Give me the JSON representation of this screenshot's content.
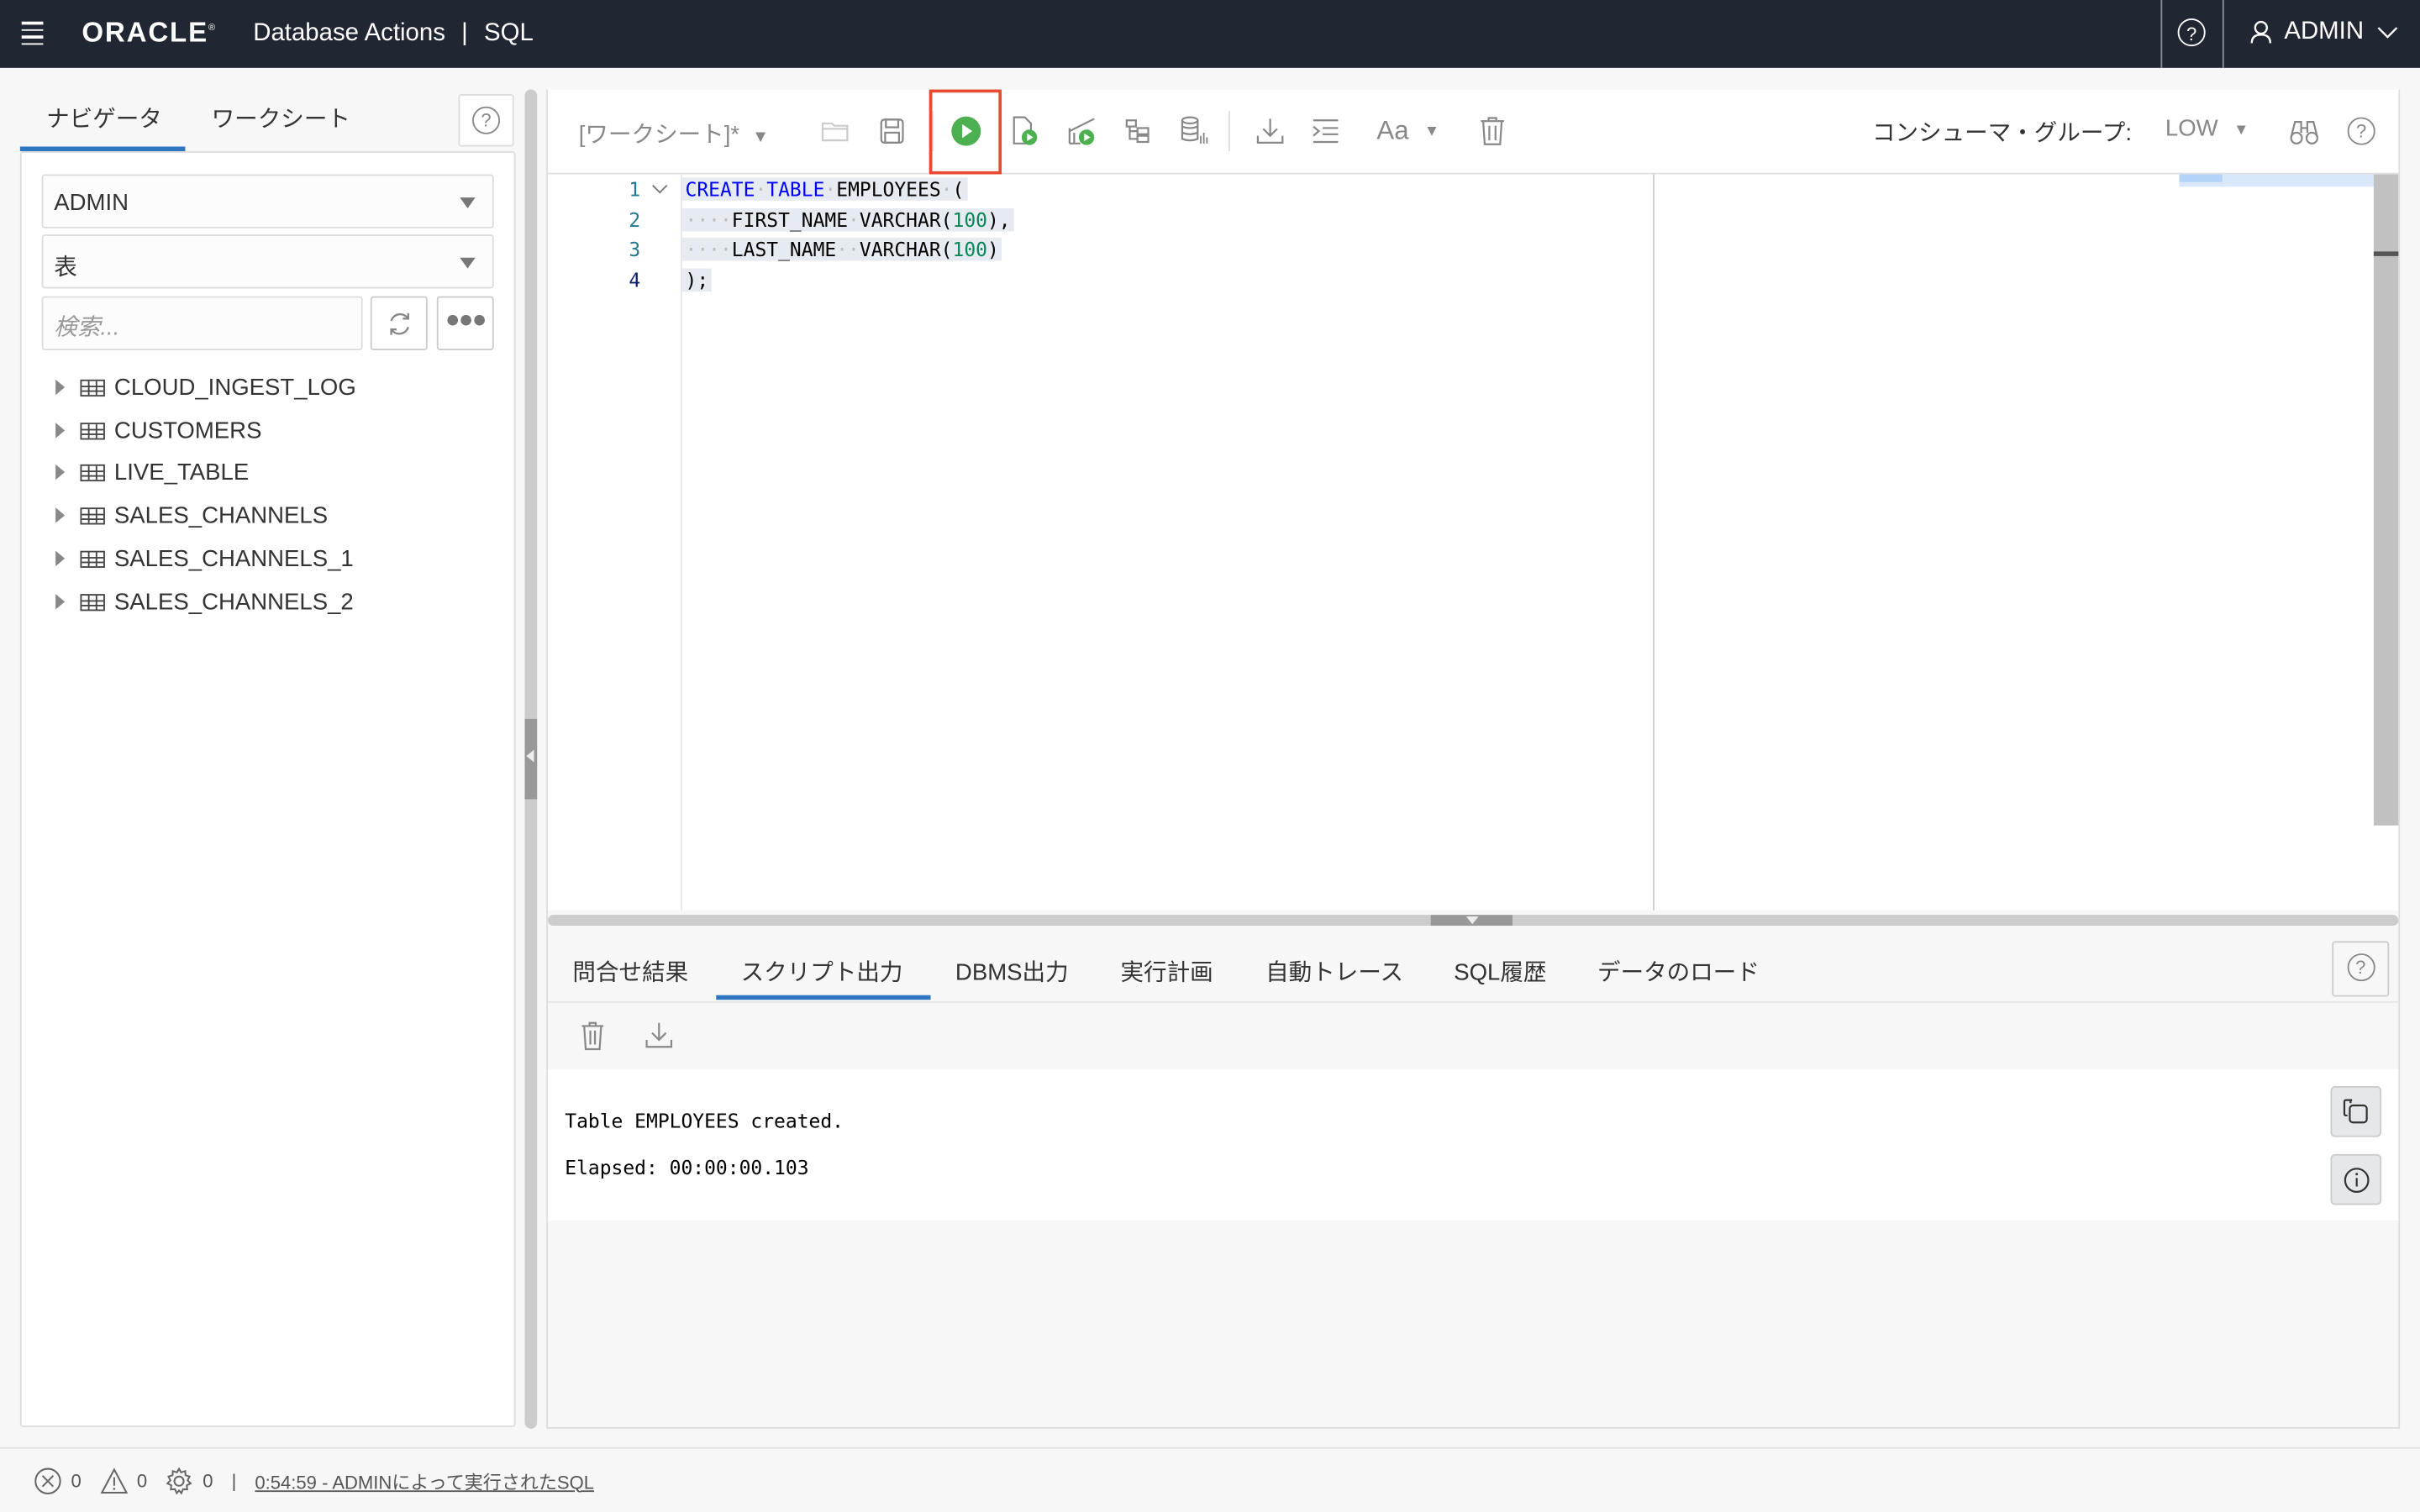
{
  "header": {
    "logo": "ORACLE",
    "app_title": "Database Actions",
    "separator": "|",
    "section": "SQL",
    "user": "ADMIN",
    "help_glyph": "?"
  },
  "navigator": {
    "tabs": [
      {
        "label": "ナビゲータ",
        "active": true
      },
      {
        "label": "ワークシート",
        "active": false
      }
    ],
    "schema": "ADMIN",
    "object_type": "表",
    "search_placeholder": "検索...",
    "tables": [
      "CLOUD_INGEST_LOG",
      "CUSTOMERS",
      "LIVE_TABLE",
      "SALES_CHANNELS",
      "SALES_CHANNELS_1",
      "SALES_CHANNELS_2"
    ]
  },
  "toolbar": {
    "worksheet_name": "[ワークシート]*",
    "consumer_group_label": "コンシューマ・グループ:",
    "consumer_group_value": "LOW",
    "font_label": "Aa",
    "highlighted_button": "run-statement-button",
    "run_color": "#4caf50",
    "highlight_color": "#e84a2f"
  },
  "editor": {
    "lines": [
      {
        "n": "1",
        "tokens": [
          [
            "kw",
            "CREATE"
          ],
          [
            "dot",
            "·"
          ],
          [
            "kw",
            "TABLE"
          ],
          [
            "dot",
            "·"
          ],
          [
            "t",
            "EMPLOYEES"
          ],
          [
            "dot",
            "·"
          ],
          [
            "t",
            "("
          ]
        ]
      },
      {
        "n": "2",
        "tokens": [
          [
            "dot",
            "····"
          ],
          [
            "t",
            "FIRST_NAME"
          ],
          [
            "dot",
            "·"
          ],
          [
            "t",
            "VARCHAR("
          ],
          [
            "num",
            "100"
          ],
          [
            "t",
            "),"
          ]
        ]
      },
      {
        "n": "3",
        "tokens": [
          [
            "dot",
            "····"
          ],
          [
            "t",
            "LAST_NAME"
          ],
          [
            "dot",
            "··"
          ],
          [
            "t",
            "VARCHAR("
          ],
          [
            "num",
            "100"
          ],
          [
            "t",
            ")"
          ]
        ]
      },
      {
        "n": "4",
        "tokens": [
          [
            "t",
            ");"
          ]
        ]
      }
    ]
  },
  "output": {
    "tabs": [
      {
        "label": "問合せ結果",
        "active": false
      },
      {
        "label": "スクリプト出力",
        "active": true
      },
      {
        "label": "DBMS出力",
        "active": false
      },
      {
        "label": "実行計画",
        "active": false
      },
      {
        "label": "自動トレース",
        "active": false
      },
      {
        "label": "SQL履歴",
        "active": false
      },
      {
        "label": "データのロード",
        "active": false
      }
    ],
    "lines": [
      "Table EMPLOYEES created.",
      "Elapsed: 00:00:00.103"
    ]
  },
  "statusbar": {
    "errors": "0",
    "warnings": "0",
    "tasks": "0",
    "separator": "|",
    "last_run": "0:54:59 - ADMINによって実行されたSQL"
  }
}
